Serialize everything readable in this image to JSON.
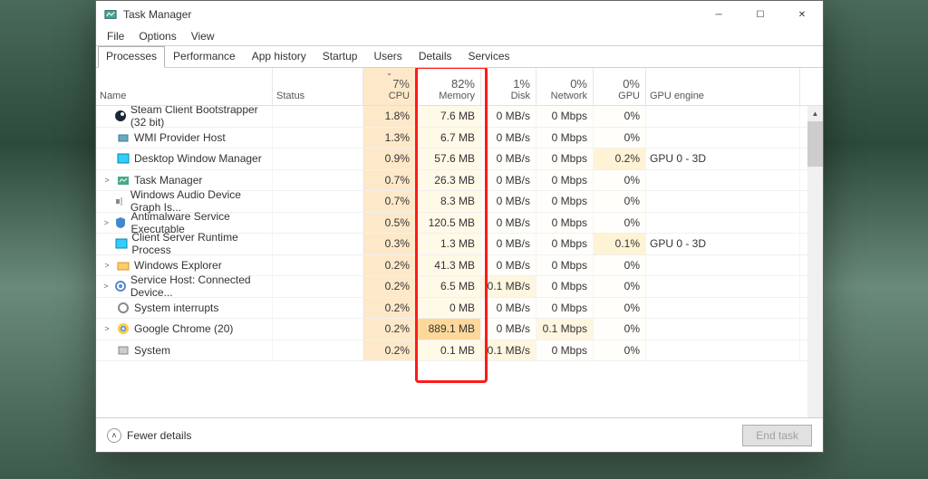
{
  "window": {
    "title": "Task Manager"
  },
  "menu": [
    "File",
    "Options",
    "View"
  ],
  "tabs": [
    "Processes",
    "Performance",
    "App history",
    "Startup",
    "Users",
    "Details",
    "Services"
  ],
  "active_tab": 0,
  "headers": {
    "name": "Name",
    "status": "Status",
    "cpu": {
      "pct": "7%",
      "label": "CPU"
    },
    "memory": {
      "pct": "82%",
      "label": "Memory"
    },
    "disk": {
      "pct": "1%",
      "label": "Disk"
    },
    "network": {
      "pct": "0%",
      "label": "Network"
    },
    "gpu": {
      "pct": "0%",
      "label": "GPU"
    },
    "engine": "GPU engine"
  },
  "rows": [
    {
      "expand": false,
      "icon": "steam-icon",
      "name": "Steam Client Bootstrapper (32 bit)",
      "cpu": "1.8%",
      "mem": "7.6 MB",
      "mem_high": false,
      "disk": "0 MB/s",
      "net": "0 Mbps",
      "gpu": "0%",
      "engine": ""
    },
    {
      "expand": false,
      "icon": "wmi-icon",
      "name": "WMI Provider Host",
      "cpu": "1.3%",
      "mem": "6.7 MB",
      "mem_high": false,
      "disk": "0 MB/s",
      "net": "0 Mbps",
      "gpu": "0%",
      "engine": ""
    },
    {
      "expand": false,
      "icon": "dwm-icon",
      "name": "Desktop Window Manager",
      "cpu": "0.9%",
      "mem": "57.6 MB",
      "mem_high": false,
      "disk": "0 MB/s",
      "net": "0 Mbps",
      "gpu": "0.2%",
      "gpu_dim": true,
      "engine": "GPU 0 - 3D"
    },
    {
      "expand": true,
      "icon": "taskmgr-icon",
      "name": "Task Manager",
      "cpu": "0.7%",
      "mem": "26.3 MB",
      "mem_high": false,
      "disk": "0 MB/s",
      "net": "0 Mbps",
      "gpu": "0%",
      "engine": ""
    },
    {
      "expand": false,
      "icon": "audio-icon",
      "name": "Windows Audio Device Graph Is...",
      "cpu": "0.7%",
      "mem": "8.3 MB",
      "mem_high": false,
      "disk": "0 MB/s",
      "net": "0 Mbps",
      "gpu": "0%",
      "engine": ""
    },
    {
      "expand": true,
      "icon": "shield-icon",
      "name": "Antimalware Service Executable",
      "cpu": "0.5%",
      "mem": "120.5 MB",
      "mem_high": false,
      "disk": "0 MB/s",
      "net": "0 Mbps",
      "gpu": "0%",
      "engine": ""
    },
    {
      "expand": false,
      "icon": "csrss-icon",
      "name": "Client Server Runtime Process",
      "cpu": "0.3%",
      "mem": "1.3 MB",
      "mem_high": false,
      "disk": "0 MB/s",
      "net": "0 Mbps",
      "gpu": "0.1%",
      "gpu_dim": true,
      "engine": "GPU 0 - 3D"
    },
    {
      "expand": true,
      "icon": "explorer-icon",
      "name": "Windows Explorer",
      "cpu": "0.2%",
      "mem": "41.3 MB",
      "mem_high": false,
      "disk": "0 MB/s",
      "net": "0 Mbps",
      "gpu": "0%",
      "engine": ""
    },
    {
      "expand": true,
      "icon": "service-icon",
      "name": "Service Host: Connected Device...",
      "cpu": "0.2%",
      "mem": "6.5 MB",
      "mem_high": false,
      "disk": "0.1 MB/s",
      "disk_dim": true,
      "net": "0 Mbps",
      "gpu": "0%",
      "engine": ""
    },
    {
      "expand": false,
      "icon": "sys-icon",
      "name": "System interrupts",
      "cpu": "0.2%",
      "mem": "0 MB",
      "mem_high": false,
      "disk": "0 MB/s",
      "net": "0 Mbps",
      "gpu": "0%",
      "engine": ""
    },
    {
      "expand": true,
      "icon": "chrome-icon",
      "name": "Google Chrome (20)",
      "cpu": "0.2%",
      "mem": "889.1 MB",
      "mem_high": true,
      "disk": "0 MB/s",
      "net": "0.1 Mbps",
      "net_dim": true,
      "gpu": "0%",
      "engine": ""
    },
    {
      "expand": false,
      "icon": "system-icon",
      "name": "System",
      "cpu": "0.2%",
      "mem": "0.1 MB",
      "mem_high": false,
      "disk": "0.1 MB/s",
      "disk_dim": true,
      "net": "0 Mbps",
      "gpu": "0%",
      "engine": ""
    }
  ],
  "footer": {
    "fewer": "Fewer details",
    "endtask": "End task"
  }
}
